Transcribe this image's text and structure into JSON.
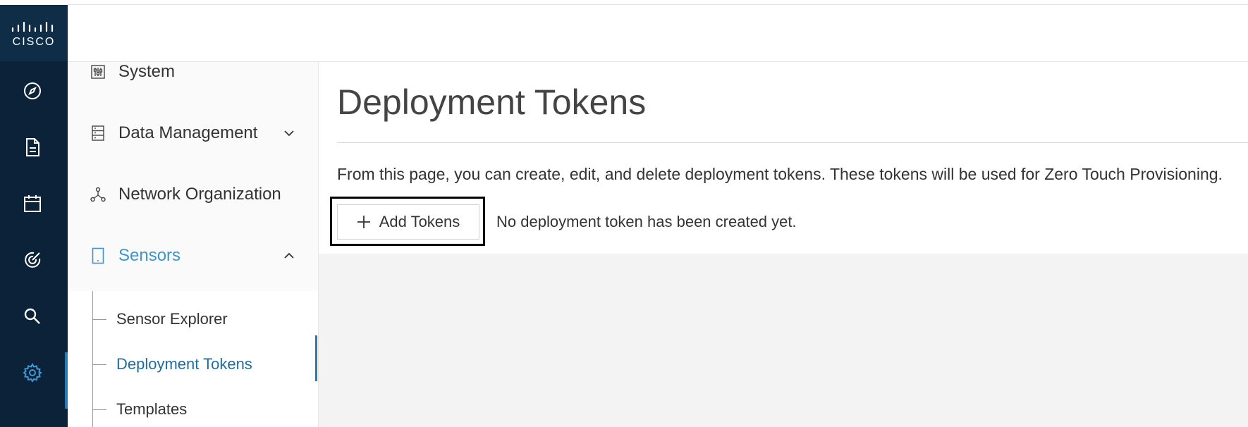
{
  "brand": {
    "logo_text": "CISCO",
    "rail_bg": "#0c2238",
    "accent": "#2a7ab0"
  },
  "rail": {
    "items": [
      {
        "icon": "compass-icon"
      },
      {
        "icon": "document-icon"
      },
      {
        "icon": "calendar-icon"
      },
      {
        "icon": "target-icon"
      },
      {
        "icon": "search-icon"
      },
      {
        "icon": "gear-icon",
        "active": true
      }
    ]
  },
  "sidebar": {
    "items": [
      {
        "label": "System",
        "icon": "sliders-icon"
      },
      {
        "label": "Data Management",
        "icon": "server-icon",
        "expanded": false
      },
      {
        "label": "Network Organization",
        "icon": "network-icon"
      },
      {
        "label": "Sensors",
        "icon": "tablet-icon",
        "expanded": true
      }
    ],
    "sensors_subitems": [
      {
        "label": "Sensor Explorer"
      },
      {
        "label": "Deployment Tokens",
        "active": true
      },
      {
        "label": "Templates"
      }
    ]
  },
  "main": {
    "title": "Deployment Tokens",
    "description": "From this page, you can create, edit, and delete deployment tokens. These tokens will be used for Zero Touch Provisioning.",
    "add_button_label": "Add Tokens",
    "empty_message": "No deployment token has been created yet."
  }
}
